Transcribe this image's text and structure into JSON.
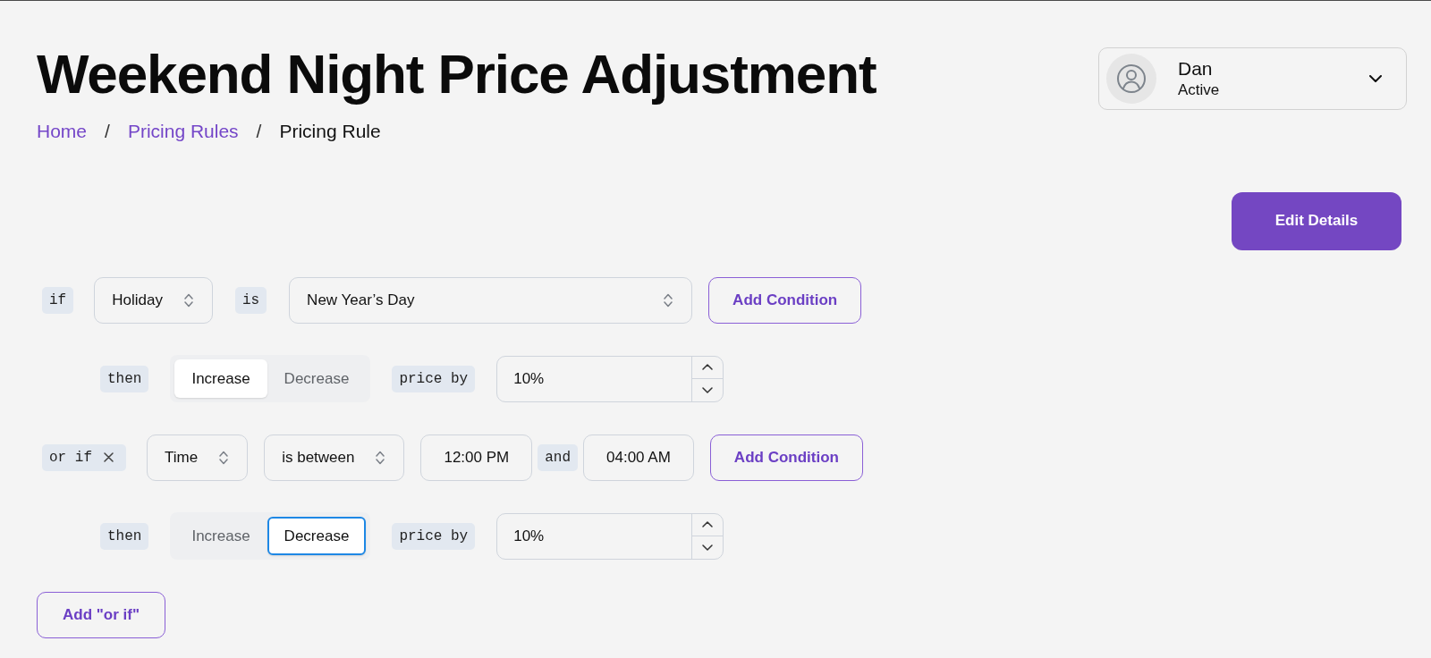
{
  "title": "Weekend Night Price Adjustment",
  "breadcrumb": [
    {
      "label": "Home",
      "kind": "link"
    },
    {
      "separator": "/",
      "label": "Pricing Rules",
      "kind": "link"
    },
    {
      "separator": "/",
      "label": "Pricing Rule",
      "kind": "current"
    }
  ],
  "user": {
    "name": "Dan",
    "status": "Active"
  },
  "edit_button": "Edit Details",
  "rules": [
    {
      "keyword": "if",
      "removable": false,
      "parts": [
        {
          "kind": "select",
          "value": "Holiday"
        },
        {
          "kind": "tag",
          "text": "is"
        },
        {
          "kind": "wide_select",
          "value": "New Year’s Day"
        }
      ],
      "add_condition": "Add Condition",
      "action": {
        "label": "then",
        "options": [
          {
            "label": "Increase",
            "selected": true,
            "focused": false
          },
          {
            "label": "Decrease",
            "selected": false,
            "focused": false
          }
        ],
        "amount_label": "price by",
        "amount": "10%"
      }
    },
    {
      "keyword": "or if",
      "removable": true,
      "parts": [
        {
          "kind": "select",
          "value": "Time"
        },
        {
          "kind": "select",
          "value": "is between"
        },
        {
          "kind": "time_input",
          "value": "12:00 PM"
        },
        {
          "kind": "inline_tag",
          "text": "and"
        },
        {
          "kind": "time_input",
          "value": "04:00 AM"
        }
      ],
      "add_condition": "Add Condition",
      "action": {
        "label": "then",
        "options": [
          {
            "label": "Increase",
            "selected": false,
            "focused": false
          },
          {
            "label": "Decrease",
            "selected": true,
            "focused": true
          }
        ],
        "amount_label": "price by",
        "amount": "10%"
      }
    }
  ],
  "add_or_if": "Add \"or if\""
}
